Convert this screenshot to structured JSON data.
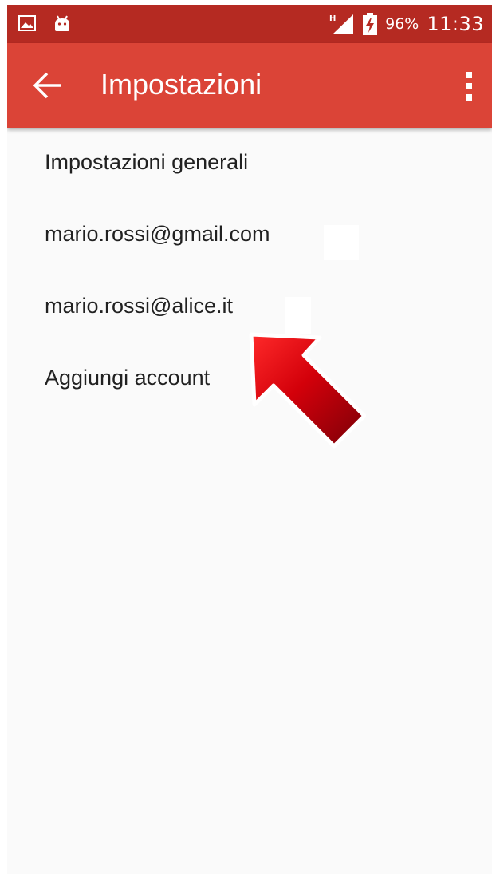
{
  "status_bar": {
    "battery_percent": "96%",
    "time": "11:33",
    "network_type": "H",
    "icons": [
      "gallery-icon",
      "android-icon",
      "signal-icon",
      "battery-charging-icon"
    ]
  },
  "app_bar": {
    "title": "Impostazioni",
    "back_icon": "arrow-back-icon",
    "menu_icon": "more-vert-icon"
  },
  "settings_list": {
    "items": [
      {
        "label": "Impostazioni generali"
      },
      {
        "label": "mario.rossi@gmail.com"
      },
      {
        "label": "mario.rossi@alice.it"
      },
      {
        "label": "Aggiungi account"
      }
    ]
  },
  "colors": {
    "status_bar": "#b52a22",
    "app_bar": "#db4437",
    "background": "#fafafa",
    "text": "#212121",
    "arrow": "#c8000a"
  }
}
